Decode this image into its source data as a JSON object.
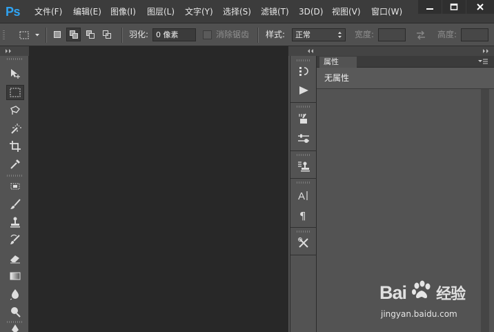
{
  "app": {
    "logo": "Ps"
  },
  "menu": [
    {
      "label": "文件(F)"
    },
    {
      "label": "编辑(E)"
    },
    {
      "label": "图像(I)"
    },
    {
      "label": "图层(L)"
    },
    {
      "label": "文字(Y)"
    },
    {
      "label": "选择(S)"
    },
    {
      "label": "滤镜(T)"
    },
    {
      "label": "3D(D)"
    },
    {
      "label": "视图(V)"
    },
    {
      "label": "窗口(W)"
    }
  ],
  "window_controls": {
    "minimize": "minimize-icon",
    "maximize": "maximize-icon",
    "close": "close-icon"
  },
  "options": {
    "feather_label": "羽化:",
    "feather_value": "0 像素",
    "antialias_label": "消除锯齿",
    "style_label": "样式:",
    "style_value": "正常",
    "width_label": "宽度:",
    "height_label": "高度:"
  },
  "tools": [
    {
      "icon": "move-tool-icon"
    },
    {
      "icon": "rectangular-marquee-tool-icon"
    },
    {
      "icon": "lasso-tool-icon"
    },
    {
      "icon": "magic-wand-tool-icon"
    },
    {
      "icon": "crop-tool-icon"
    },
    {
      "icon": "eyedropper-tool-icon"
    },
    {
      "icon": "spot-healing-brush-tool-icon"
    },
    {
      "icon": "brush-tool-icon"
    },
    {
      "icon": "clone-stamp-tool-icon"
    },
    {
      "icon": "history-brush-tool-icon"
    },
    {
      "icon": "eraser-tool-icon"
    },
    {
      "icon": "gradient-tool-icon"
    },
    {
      "icon": "blur-tool-icon"
    },
    {
      "icon": "dodge-tool-icon"
    },
    {
      "icon": "pen-tool-icon"
    }
  ],
  "properties_panel": {
    "tab_label": "属性",
    "empty_label": "无属性"
  },
  "watermark": {
    "main": "Bai",
    "main2": "经验",
    "sub": "jingyan.baidu.com"
  },
  "colors": {
    "menubar": "#3c3c3c",
    "canvas": "#282828",
    "panel": "#535353",
    "logo": "#2fa3f2"
  }
}
